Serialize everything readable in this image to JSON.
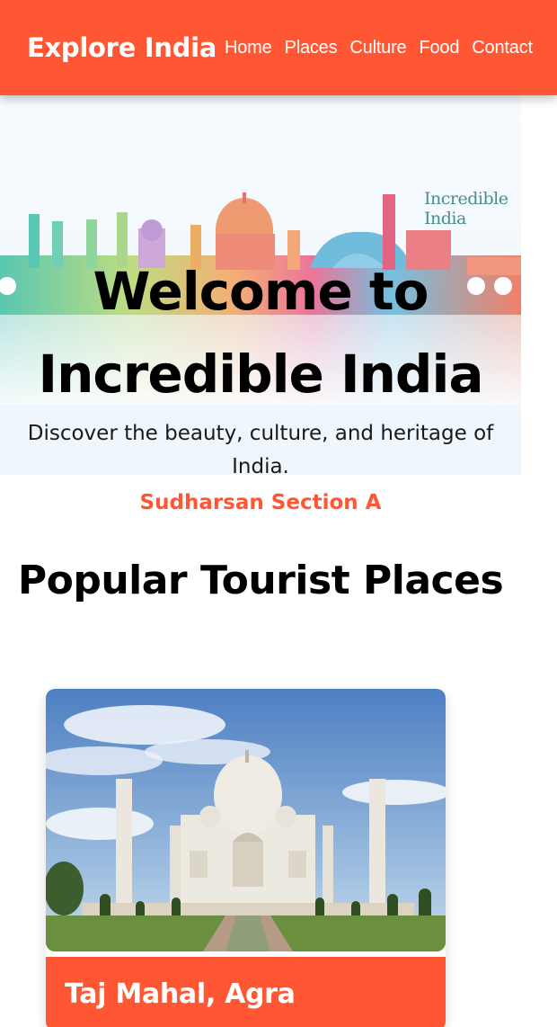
{
  "navbar": {
    "brand": "Explore India",
    "links": [
      "Home",
      "Places",
      "Culture",
      "Food",
      "Contact"
    ]
  },
  "hero": {
    "logo": "Incredible India",
    "title": "Welcome to Incredible India",
    "subtitle": "Discover the beauty, culture, and heritage of India."
  },
  "section_tag": "Sudharsan Section A",
  "section_heading": "Popular Tourist Places",
  "cards": [
    {
      "title": "Taj Mahal, Agra",
      "image": "taj-mahal-photo"
    }
  ],
  "colors": {
    "accent": "#ff5733",
    "text": "#000000",
    "white": "#ffffff"
  }
}
